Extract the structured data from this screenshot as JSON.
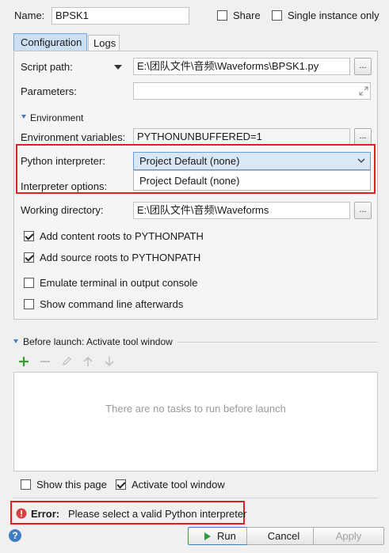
{
  "name": {
    "label": "Name:",
    "value": "BPSK1"
  },
  "share": {
    "label": "Share",
    "checked": false
  },
  "single_instance": {
    "label": "Single instance only",
    "checked": false
  },
  "tabs": [
    {
      "label": "Configuration",
      "active": true
    },
    {
      "label": "Logs",
      "active": false
    }
  ],
  "script_path": {
    "label": "Script path:",
    "value": "E:\\团队文件\\音频\\Waveforms\\BPSK1.py",
    "browse": "..."
  },
  "parameters": {
    "label": "Parameters:",
    "value": ""
  },
  "environment": {
    "section_label": "Environment",
    "env_vars": {
      "label": "Environment variables:",
      "value": "PYTHONUNBUFFERED=1",
      "browse": "..."
    },
    "interpreter": {
      "label": "Python interpreter:",
      "value": "Project Default (none)"
    },
    "interpreter_options": {
      "label": "Interpreter options:"
    },
    "dropdown_options": [
      "Project Default (none)"
    ]
  },
  "working_directory": {
    "label": "Working directory:",
    "value": "E:\\团队文件\\音频\\Waveforms",
    "browse": "..."
  },
  "options": [
    {
      "label": "Add content roots to PYTHONPATH",
      "checked": true
    },
    {
      "label": "Add source roots to PYTHONPATH",
      "checked": true
    },
    {
      "label": "Emulate terminal in output console",
      "checked": false
    },
    {
      "label": "Show command line afterwards",
      "checked": false
    }
  ],
  "before_launch": {
    "title": "Before launch: Activate tool window",
    "empty_text": "There are no tasks to run before launch",
    "toolbar_icons": [
      "add-icon",
      "remove-icon",
      "edit-icon",
      "move-up-icon",
      "move-down-icon"
    ]
  },
  "show_this_page": {
    "label": "Show this page",
    "checked": false
  },
  "activate_tool_window": {
    "label": "Activate tool window",
    "checked": true
  },
  "error": {
    "prefix": "Error:",
    "message": "Please select a valid Python interpreter"
  },
  "buttons": {
    "run": "Run",
    "cancel": "Cancel",
    "apply": "Apply",
    "help": "?"
  },
  "colors": {
    "accent": "#3d7ec4",
    "error_red": "#e02020",
    "add_green": "#3a9a3a",
    "run_green": "#2e9a3e"
  }
}
